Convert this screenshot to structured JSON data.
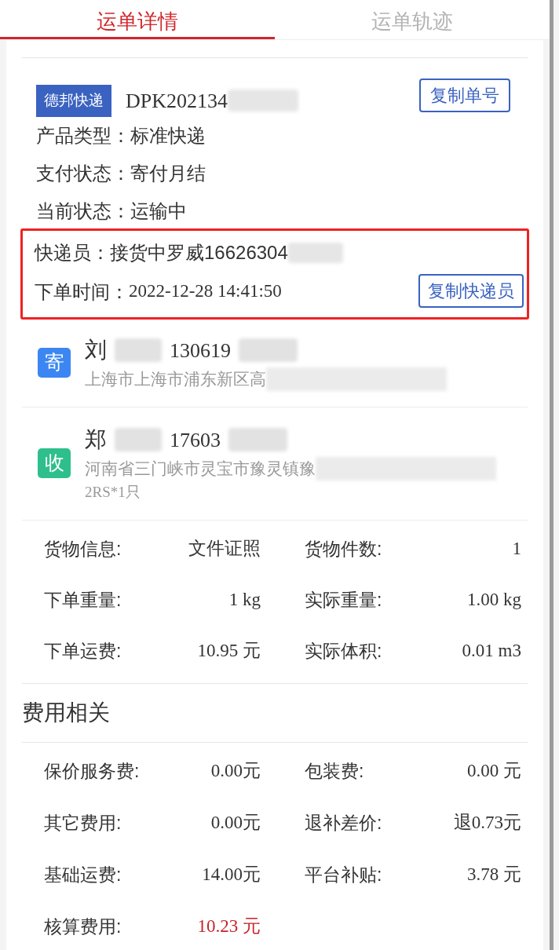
{
  "tabs": [
    {
      "label": "运单详情",
      "selected": true
    },
    {
      "label": "运单轨迹",
      "selected": false
    }
  ],
  "waybill": {
    "carrier": "德邦快递",
    "number": "DPK202134",
    "copy_button": "复制单号"
  },
  "info": [
    {
      "label": "产品类型：",
      "value": "标准快递"
    },
    {
      "label": "支付状态：",
      "value": "寄付月结"
    },
    {
      "label": "当前状态：",
      "value": "运输中"
    }
  ],
  "highlighted": {
    "rows": [
      {
        "label": "快递员：",
        "value": "接货中罗威16626304"
      },
      {
        "label": "下单时间：",
        "value": "2022-12-28 14:41:50"
      }
    ],
    "copy_button": "复制快递员"
  },
  "parties": [
    {
      "badge": "寄",
      "color": "#3b86f2",
      "name": "刘",
      "phone": "130619",
      "address": "上海市上海市浦东新区高"
    },
    {
      "badge": "收",
      "color": "#2fbf8c",
      "name": "郑",
      "phone": "17603",
      "address": "河南省三门峡市灵宝市豫灵镇豫",
      "note": "2RS*1只"
    }
  ],
  "goods": [
    {
      "label": "货物信息:",
      "value": "文件证照"
    },
    {
      "label": "货物件数:",
      "value": "1"
    },
    {
      "label": "下单重量:",
      "value": "1 kg"
    },
    {
      "label": "实际重量:",
      "value": "1.00 kg"
    },
    {
      "label": "下单运费:",
      "value": "10.95 元"
    },
    {
      "label": "实际体积:",
      "value": "0.01 m3"
    }
  ],
  "fees": {
    "title": "费用相关",
    "items": [
      {
        "label": "保价服务费:",
        "value": "0.00元"
      },
      {
        "label": "包装费:",
        "value": "0.00 元"
      },
      {
        "label": "其它费用:",
        "value": "0.00元"
      },
      {
        "label": "退补差价:",
        "value": "退0.73元"
      },
      {
        "label": "基础运费:",
        "value": "14.00元"
      },
      {
        "label": "平台补贴:",
        "value": "3.78 元"
      },
      {
        "label": "核算费用:",
        "value": "10.23 元",
        "kind": "total"
      }
    ]
  }
}
